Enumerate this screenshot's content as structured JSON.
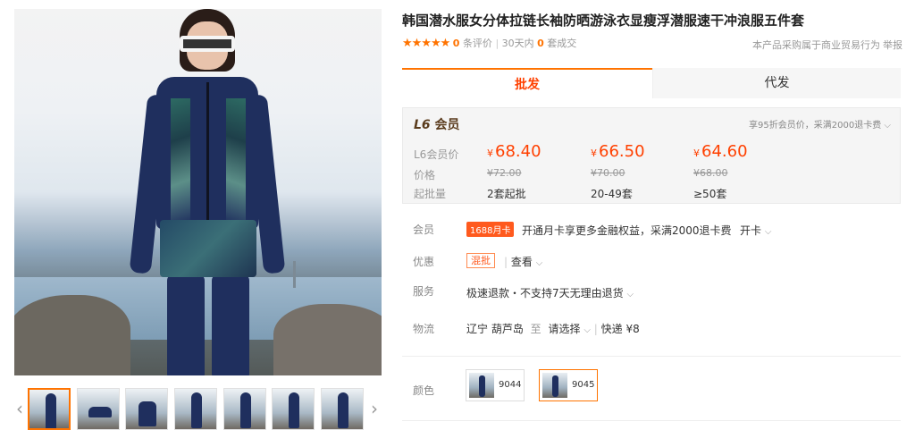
{
  "product": {
    "title": "韩国潜水服女分体拉链长袖防晒游泳衣显瘦浮潜服速干冲浪服五件套",
    "stars": "★★★★★",
    "review_count": "0",
    "review_label": "条评价",
    "deal_prefix": "30天内",
    "deal_count": "0",
    "deal_label": "套成交",
    "commerce_note": "本产品采购属于商业贸易行为",
    "report_label": "举报"
  },
  "tabs": [
    {
      "label": "批发"
    },
    {
      "label": "代发"
    }
  ],
  "pricing": {
    "level": "L6",
    "member_label": "会员",
    "member_note": "享95折会员价，采满2000退卡费",
    "row_labels": [
      "L6会员价",
      "价格",
      "起批量"
    ],
    "currency": "¥",
    "tiers": [
      {
        "member_price": "68.40",
        "original_price": "¥72.00",
        "min_qty": "2套起批"
      },
      {
        "member_price": "66.50",
        "original_price": "¥70.00",
        "min_qty": "20-49套"
      },
      {
        "member_price": "64.60",
        "original_price": "¥68.00",
        "min_qty": "≥50套"
      }
    ]
  },
  "details": {
    "member": {
      "label": "会员",
      "tag": "1688月卡",
      "text": "开通月卡享更多金融权益，采满2000退卡费",
      "link": "开卡"
    },
    "discount": {
      "label": "优惠",
      "tag": "混批",
      "link": "查看"
    },
    "service": {
      "label": "服务",
      "text": "极速退款・不支持7天无理由退货"
    },
    "logistics": {
      "label": "物流",
      "origin": "辽宁 葫芦岛",
      "to": "至",
      "destination": "请选择",
      "method": "快递",
      "fee": "¥8"
    }
  },
  "color": {
    "label": "颜色",
    "options": [
      {
        "name": "9044",
        "selected": false
      },
      {
        "name": "9045",
        "selected": true
      }
    ]
  },
  "gallery": {
    "prev": "‹",
    "next": "›"
  },
  "colors": {
    "accent": "#ff7300",
    "price": "#ff4000"
  }
}
